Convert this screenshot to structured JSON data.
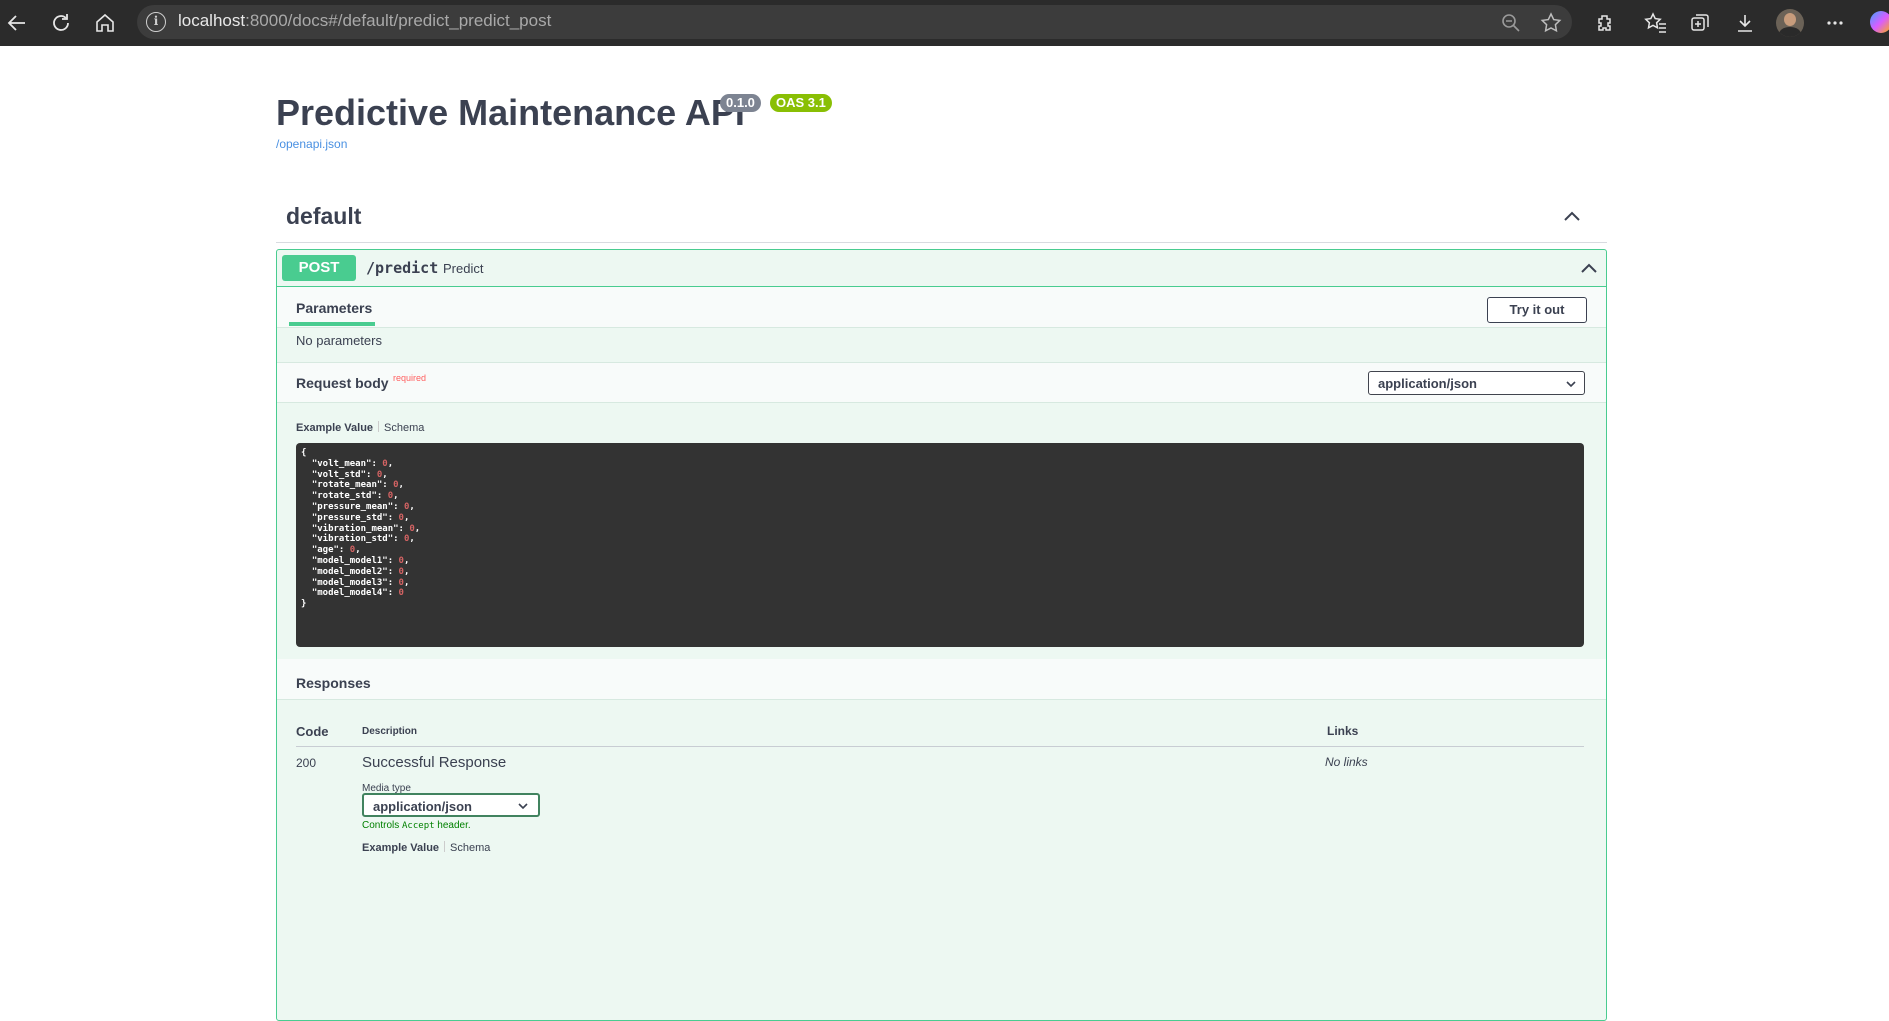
{
  "browser": {
    "url_host": "localhost",
    "url_path": ":8000/docs#/default/predict_predict_post",
    "icons": [
      "back-icon",
      "reload-icon",
      "home-icon",
      "info-icon",
      "zoom-icon",
      "star-icon",
      "extensions-icon",
      "favorites-icon",
      "collections-icon",
      "download-icon",
      "profile-avatar",
      "more-icon"
    ]
  },
  "api": {
    "title": "Predictive Maintenance API",
    "version": "0.1.0",
    "oas": "OAS 3.1",
    "spec_link": "/openapi.json"
  },
  "tag": {
    "name": "default"
  },
  "operation": {
    "method": "POST",
    "path": "/predict",
    "summary": "Predict",
    "tab_label": "Parameters",
    "try_label": "Try it out",
    "no_params": "No parameters",
    "request_body_label": "Request body",
    "required_label": "required",
    "content_type": "application/json",
    "example_value_label": "Example Value",
    "schema_label": "Schema",
    "example_lines": [
      {
        "key": "{",
        "val": "",
        "end": ""
      },
      {
        "key": "  \"volt_mean\": ",
        "val": "0",
        "end": ","
      },
      {
        "key": "  \"volt_std\": ",
        "val": "0",
        "end": ","
      },
      {
        "key": "  \"rotate_mean\": ",
        "val": "0",
        "end": ","
      },
      {
        "key": "  \"rotate_std\": ",
        "val": "0",
        "end": ","
      },
      {
        "key": "  \"pressure_mean\": ",
        "val": "0",
        "end": ","
      },
      {
        "key": "  \"pressure_std\": ",
        "val": "0",
        "end": ","
      },
      {
        "key": "  \"vibration_mean\": ",
        "val": "0",
        "end": ","
      },
      {
        "key": "  \"vibration_std\": ",
        "val": "0",
        "end": ","
      },
      {
        "key": "  \"age\": ",
        "val": "0",
        "end": ","
      },
      {
        "key": "  \"model_model1\": ",
        "val": "0",
        "end": ","
      },
      {
        "key": "  \"model_model2\": ",
        "val": "0",
        "end": ","
      },
      {
        "key": "  \"model_model3\": ",
        "val": "0",
        "end": ","
      },
      {
        "key": "  \"model_model4\": ",
        "val": "0",
        "end": ""
      },
      {
        "key": "}",
        "val": "",
        "end": ""
      }
    ]
  },
  "responses": {
    "title": "Responses",
    "col_code": "Code",
    "col_description": "Description",
    "col_links": "Links",
    "rows": [
      {
        "code": "200",
        "description": "Successful Response",
        "links": "No links",
        "media_type_label": "Media type",
        "media_type": "application/json",
        "controls_prefix": "Controls ",
        "controls_code": "Accept",
        "controls_suffix": " header.",
        "example_value_label": "Example Value",
        "schema_label": "Schema"
      }
    ]
  }
}
